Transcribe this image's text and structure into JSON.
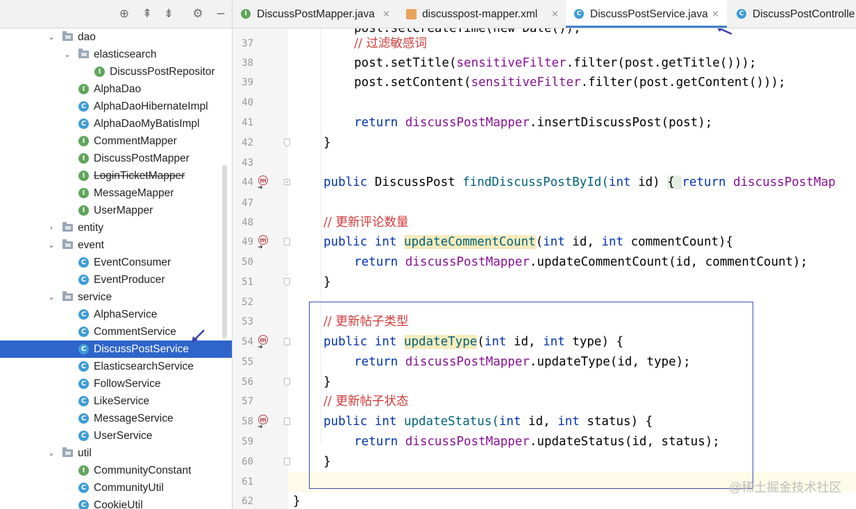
{
  "toolbar": {
    "icons": [
      "target-icon",
      "collapse-icon",
      "expand-icon",
      "gear-icon",
      "minimize-icon"
    ],
    "glyphs": [
      "⊕",
      "⇞",
      "⇟",
      "⚙",
      "−"
    ]
  },
  "tree": [
    {
      "label": "dao",
      "type": "folder",
      "chev": "⌄",
      "indent": 0
    },
    {
      "label": "elasticsearch",
      "type": "folder",
      "chev": "⌄",
      "indent": 1
    },
    {
      "label": "DiscussPostRepositor",
      "type": "i",
      "indent": 2
    },
    {
      "label": "AlphaDao",
      "type": "i",
      "indent": 1
    },
    {
      "label": "AlphaDaoHibernateImpl",
      "type": "c",
      "indent": 1
    },
    {
      "label": "AlphaDaoMyBatisImpl",
      "type": "c",
      "indent": 1
    },
    {
      "label": "CommentMapper",
      "type": "i",
      "indent": 1
    },
    {
      "label": "DiscussPostMapper",
      "type": "i",
      "indent": 1
    },
    {
      "label": "LoginTicketMapper",
      "type": "i",
      "indent": 1,
      "strike": true
    },
    {
      "label": "MessageMapper",
      "type": "i",
      "indent": 1
    },
    {
      "label": "UserMapper",
      "type": "i",
      "indent": 1
    },
    {
      "label": "entity",
      "type": "folder",
      "chev": "›",
      "indent": 0
    },
    {
      "label": "event",
      "type": "folder",
      "chev": "⌄",
      "indent": 0
    },
    {
      "label": "EventConsumer",
      "type": "c",
      "indent": 1
    },
    {
      "label": "EventProducer",
      "type": "c",
      "indent": 1
    },
    {
      "label": "service",
      "type": "folder",
      "chev": "⌄",
      "indent": 0
    },
    {
      "label": "AlphaService",
      "type": "c",
      "indent": 1
    },
    {
      "label": "CommentService",
      "type": "c",
      "indent": 1
    },
    {
      "label": "DiscussPostService",
      "type": "c",
      "indent": 1,
      "selected": true
    },
    {
      "label": "ElasticsearchService",
      "type": "c",
      "indent": 1
    },
    {
      "label": "FollowService",
      "type": "c",
      "indent": 1
    },
    {
      "label": "LikeService",
      "type": "c",
      "indent": 1
    },
    {
      "label": "MessageService",
      "type": "c",
      "indent": 1
    },
    {
      "label": "UserService",
      "type": "c",
      "indent": 1
    },
    {
      "label": "util",
      "type": "folder",
      "chev": "⌄",
      "indent": 0
    },
    {
      "label": "CommunityConstant",
      "type": "i",
      "indent": 1
    },
    {
      "label": "CommunityUtil",
      "type": "c",
      "indent": 1
    },
    {
      "label": "CookieUtil",
      "type": "c",
      "indent": 1
    }
  ],
  "badge_letters": {
    "i": "I",
    "c": "C"
  },
  "tabs": [
    {
      "label": "DiscussPostMapper.java",
      "badge": "I",
      "close": "×"
    },
    {
      "label": "discusspost-mapper.xml",
      "badge": "xml",
      "close": "×"
    },
    {
      "label": "DiscussPostService.java",
      "badge": "C",
      "close": "×",
      "active": true
    },
    {
      "label": "DiscussPostControlle",
      "badge": "C",
      "close": ""
    }
  ],
  "gutter": {
    "line_numbers": [
      "37",
      "38",
      "39",
      "40",
      "41",
      "42",
      "43",
      "44",
      "47",
      "48",
      "49",
      "50",
      "51",
      "52",
      "53",
      "54",
      "55",
      "56",
      "57",
      "58",
      "59",
      "60",
      "61",
      "62"
    ],
    "method_marker": "m"
  },
  "code": {
    "l37_comment": "// 过滤敏感词",
    "l38": {
      "a": "post.setTitle(",
      "b": "sensitiveFilter",
      "c": ".filter(post.getTitle()));"
    },
    "l39": {
      "a": "post.setContent(",
      "b": "sensitiveFilter",
      "c": ".filter(post.getContent()));"
    },
    "l41": {
      "kw": "return ",
      "fld": "discussPostMapper",
      "rest": ".insertDiscussPost(post);"
    },
    "l42": "}",
    "l44": {
      "kw1": "public ",
      "type": "DiscussPost ",
      "name": "findDiscussPostById(",
      "kw2": "int ",
      "arg": "id) ",
      "brace": "{ ",
      "kw3": "return ",
      "fld": "discussPostMap"
    },
    "l48_comment": "// 更新评论数量",
    "l49": {
      "kw1": "public ",
      "kw2": "int ",
      "name": "updateCommentCount",
      "p1": "(",
      "kw3": "int ",
      "a1": "id, ",
      "kw4": "int ",
      "a2": "commentCount){"
    },
    "l50": {
      "kw": "return ",
      "fld": "discussPostMapper",
      "rest": ".updateCommentCount(id, commentCount);"
    },
    "l51": "}",
    "l53_comment": "// 更新帖子类型",
    "l54": {
      "kw1": "public ",
      "kw2": "int ",
      "name": "updateType",
      "p1": "(",
      "kw3": "int ",
      "a1": "id, ",
      "kw4": "int ",
      "a2": "type) {"
    },
    "l55": {
      "kw": "return ",
      "fld": "discussPostMapper",
      "rest": ".updateType(id, type);"
    },
    "l56": "}",
    "l57_comment": "// 更新帖子状态",
    "l58": {
      "kw1": "public ",
      "kw2": "int ",
      "name": "updateStatus(",
      "kw3": "int ",
      "a1": "id, ",
      "kw4": "int ",
      "a2": "status) {"
    },
    "l59": {
      "kw": "return ",
      "fld": "discussPostMapper",
      "rest": ".updateStatus(id, status);"
    },
    "l60": "}",
    "l62": "}"
  },
  "watermark": "@稀土掘金技术社区",
  "colors": {
    "selection": "#2f65ca",
    "keyword": "#0033b3",
    "field": "#871094",
    "comment": "#d13b3b",
    "annotation_box": "#3c4fb0"
  }
}
